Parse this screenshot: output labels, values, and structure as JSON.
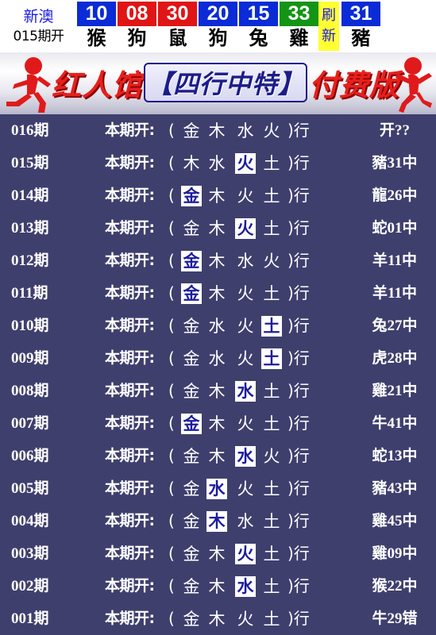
{
  "header": {
    "brand_line1": "新澳",
    "brand_line2": "015期开",
    "draws": [
      {
        "num": "10",
        "zodiac": "猴",
        "color": "#0a2bd6"
      },
      {
        "num": "08",
        "zodiac": "狗",
        "color": "#e01515"
      },
      {
        "num": "30",
        "zodiac": "鼠",
        "color": "#e01515"
      },
      {
        "num": "20",
        "zodiac": "狗",
        "color": "#0a2bd6"
      },
      {
        "num": "15",
        "zodiac": "兔",
        "color": "#0a2bd6"
      },
      {
        "num": "33",
        "zodiac": "雞",
        "color": "#149414"
      }
    ],
    "refresh_top": "刷",
    "refresh_bottom": "新",
    "special": {
      "num": "31",
      "zodiac": "豬",
      "color": "#0a2bd6"
    }
  },
  "banner": {
    "title_left": "红人馆",
    "title_mid": "【四行中特】",
    "title_right": "付费版"
  },
  "rows": [
    {
      "period": "016期",
      "label": "本期开:",
      "paren_l": "(",
      "elements": [
        "金",
        "木",
        "水",
        "火"
      ],
      "highlight": -1,
      "paren_r": ")行",
      "result": "开??"
    },
    {
      "period": "015期",
      "label": "本期开:",
      "paren_l": "(",
      "elements": [
        "木",
        "水",
        "火",
        "土"
      ],
      "highlight": 2,
      "paren_r": ")行",
      "result": "豬31中"
    },
    {
      "period": "014期",
      "label": "本期开:",
      "paren_l": "(",
      "elements": [
        "金",
        "木",
        "火",
        "土"
      ],
      "highlight": 0,
      "paren_r": ")行",
      "result": "龍26中"
    },
    {
      "period": "013期",
      "label": "本期开:",
      "paren_l": "(",
      "elements": [
        "金",
        "木",
        "火",
        "土"
      ],
      "highlight": 2,
      "paren_r": ")行",
      "result": "蛇01中"
    },
    {
      "period": "012期",
      "label": "本期开:",
      "paren_l": "(",
      "elements": [
        "金",
        "木",
        "水",
        "火"
      ],
      "highlight": 0,
      "paren_r": ")行",
      "result": "羊11中"
    },
    {
      "period": "011期",
      "label": "本期开:",
      "paren_l": "(",
      "elements": [
        "金",
        "木",
        "火",
        "土"
      ],
      "highlight": 0,
      "paren_r": ")行",
      "result": "羊11中"
    },
    {
      "period": "010期",
      "label": "本期开:",
      "paren_l": "(",
      "elements": [
        "金",
        "水",
        "火",
        "土"
      ],
      "highlight": 3,
      "paren_r": ")行",
      "result": "兔27中"
    },
    {
      "period": "009期",
      "label": "本期开:",
      "paren_l": "(",
      "elements": [
        "金",
        "水",
        "火",
        "土"
      ],
      "highlight": 3,
      "paren_r": ")行",
      "result": "虎28中"
    },
    {
      "period": "008期",
      "label": "本期开:",
      "paren_l": "(",
      "elements": [
        "金",
        "木",
        "水",
        "土"
      ],
      "highlight": 2,
      "paren_r": ")行",
      "result": "雞21中"
    },
    {
      "period": "007期",
      "label": "本期开:",
      "paren_l": "(",
      "elements": [
        "金",
        "木",
        "火",
        "土"
      ],
      "highlight": 0,
      "paren_r": ")行",
      "result": "牛41中"
    },
    {
      "period": "006期",
      "label": "本期开:",
      "paren_l": "(",
      "elements": [
        "金",
        "木",
        "水",
        "火"
      ],
      "highlight": 2,
      "paren_r": ")行",
      "result": "蛇13中"
    },
    {
      "period": "005期",
      "label": "本期开:",
      "paren_l": "(",
      "elements": [
        "金",
        "水",
        "火",
        "土"
      ],
      "highlight": 1,
      "paren_r": ")行",
      "result": "豬43中"
    },
    {
      "period": "004期",
      "label": "本期开:",
      "paren_l": "(",
      "elements": [
        "金",
        "木",
        "水",
        "土"
      ],
      "highlight": 1,
      "paren_r": ")行",
      "result": "雞45中"
    },
    {
      "period": "003期",
      "label": "本期开:",
      "paren_l": "(",
      "elements": [
        "金",
        "木",
        "火",
        "土"
      ],
      "highlight": 2,
      "paren_r": ")行",
      "result": "雞09中"
    },
    {
      "period": "002期",
      "label": "本期开:",
      "paren_l": "(",
      "elements": [
        "金",
        "木",
        "水",
        "土"
      ],
      "highlight": 2,
      "paren_r": ")行",
      "result": "猴22中"
    },
    {
      "period": "001期",
      "label": "本期开:",
      "paren_l": "(",
      "elements": [
        "金",
        "木",
        "火",
        "土"
      ],
      "highlight": -1,
      "paren_r": ")行",
      "result": "牛29错"
    }
  ]
}
